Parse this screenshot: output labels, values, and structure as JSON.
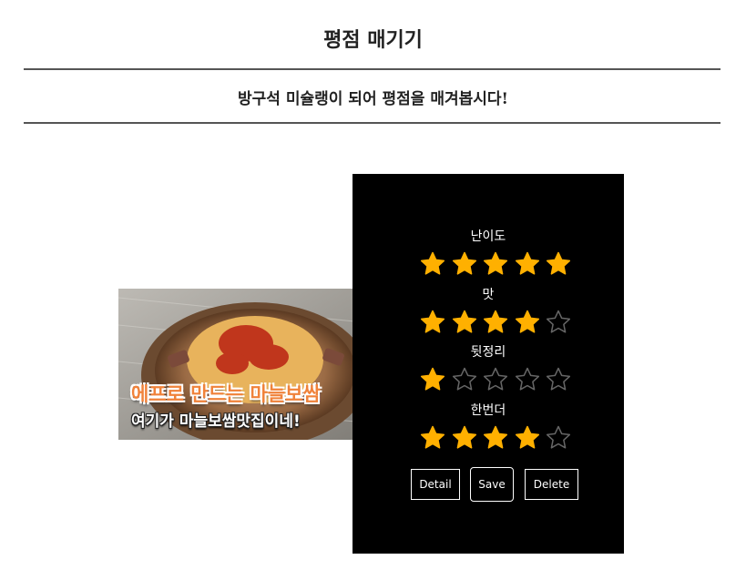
{
  "header": {
    "title": "평점 매기기",
    "subtitle": "방구석 미슐랭이 되어 평점을 매겨봅시다!"
  },
  "card": {
    "thumbnail": {
      "caption_main": "에프로 만드는 마늘보쌈",
      "caption_sub": "여기가 마늘보쌈맛집이네!"
    },
    "categories": [
      {
        "label": "난이도",
        "rating": 5,
        "max": 5
      },
      {
        "label": "맛",
        "rating": 4,
        "max": 5
      },
      {
        "label": "뒷정리",
        "rating": 1,
        "max": 5
      },
      {
        "label": "한번더",
        "rating": 4,
        "max": 5
      }
    ],
    "buttons": {
      "detail": "Detail",
      "save": "Save",
      "delete": "Delete"
    }
  },
  "colors": {
    "star_filled": "#FFB000",
    "star_empty_stroke": "#666666",
    "panel_bg": "#000000"
  }
}
